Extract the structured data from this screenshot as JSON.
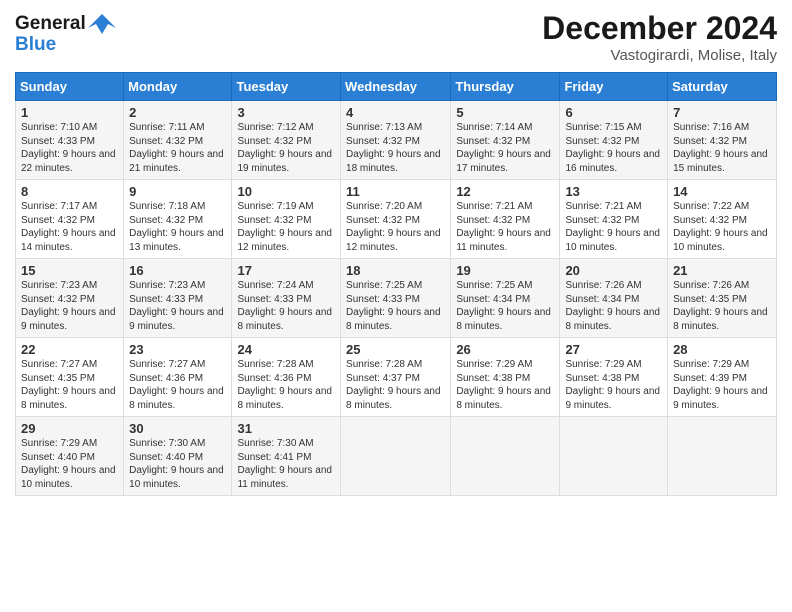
{
  "logo": {
    "line1": "General",
    "line2": "Blue"
  },
  "title": "December 2024",
  "subtitle": "Vastogirardi, Molise, Italy",
  "days": [
    "Sunday",
    "Monday",
    "Tuesday",
    "Wednesday",
    "Thursday",
    "Friday",
    "Saturday"
  ],
  "weeks": [
    [
      {
        "day": "1",
        "sunrise": "7:10 AM",
        "sunset": "4:33 PM",
        "daylight": "9 hours and 22 minutes."
      },
      {
        "day": "2",
        "sunrise": "7:11 AM",
        "sunset": "4:32 PM",
        "daylight": "9 hours and 21 minutes."
      },
      {
        "day": "3",
        "sunrise": "7:12 AM",
        "sunset": "4:32 PM",
        "daylight": "9 hours and 19 minutes."
      },
      {
        "day": "4",
        "sunrise": "7:13 AM",
        "sunset": "4:32 PM",
        "daylight": "9 hours and 18 minutes."
      },
      {
        "day": "5",
        "sunrise": "7:14 AM",
        "sunset": "4:32 PM",
        "daylight": "9 hours and 17 minutes."
      },
      {
        "day": "6",
        "sunrise": "7:15 AM",
        "sunset": "4:32 PM",
        "daylight": "9 hours and 16 minutes."
      },
      {
        "day": "7",
        "sunrise": "7:16 AM",
        "sunset": "4:32 PM",
        "daylight": "9 hours and 15 minutes."
      }
    ],
    [
      {
        "day": "8",
        "sunrise": "7:17 AM",
        "sunset": "4:32 PM",
        "daylight": "9 hours and 14 minutes."
      },
      {
        "day": "9",
        "sunrise": "7:18 AM",
        "sunset": "4:32 PM",
        "daylight": "9 hours and 13 minutes."
      },
      {
        "day": "10",
        "sunrise": "7:19 AM",
        "sunset": "4:32 PM",
        "daylight": "9 hours and 12 minutes."
      },
      {
        "day": "11",
        "sunrise": "7:20 AM",
        "sunset": "4:32 PM",
        "daylight": "9 hours and 12 minutes."
      },
      {
        "day": "12",
        "sunrise": "7:21 AM",
        "sunset": "4:32 PM",
        "daylight": "9 hours and 11 minutes."
      },
      {
        "day": "13",
        "sunrise": "7:21 AM",
        "sunset": "4:32 PM",
        "daylight": "9 hours and 10 minutes."
      },
      {
        "day": "14",
        "sunrise": "7:22 AM",
        "sunset": "4:32 PM",
        "daylight": "9 hours and 10 minutes."
      }
    ],
    [
      {
        "day": "15",
        "sunrise": "7:23 AM",
        "sunset": "4:32 PM",
        "daylight": "9 hours and 9 minutes."
      },
      {
        "day": "16",
        "sunrise": "7:23 AM",
        "sunset": "4:33 PM",
        "daylight": "9 hours and 9 minutes."
      },
      {
        "day": "17",
        "sunrise": "7:24 AM",
        "sunset": "4:33 PM",
        "daylight": "9 hours and 8 minutes."
      },
      {
        "day": "18",
        "sunrise": "7:25 AM",
        "sunset": "4:33 PM",
        "daylight": "9 hours and 8 minutes."
      },
      {
        "day": "19",
        "sunrise": "7:25 AM",
        "sunset": "4:34 PM",
        "daylight": "9 hours and 8 minutes."
      },
      {
        "day": "20",
        "sunrise": "7:26 AM",
        "sunset": "4:34 PM",
        "daylight": "9 hours and 8 minutes."
      },
      {
        "day": "21",
        "sunrise": "7:26 AM",
        "sunset": "4:35 PM",
        "daylight": "9 hours and 8 minutes."
      }
    ],
    [
      {
        "day": "22",
        "sunrise": "7:27 AM",
        "sunset": "4:35 PM",
        "daylight": "9 hours and 8 minutes."
      },
      {
        "day": "23",
        "sunrise": "7:27 AM",
        "sunset": "4:36 PM",
        "daylight": "9 hours and 8 minutes."
      },
      {
        "day": "24",
        "sunrise": "7:28 AM",
        "sunset": "4:36 PM",
        "daylight": "9 hours and 8 minutes."
      },
      {
        "day": "25",
        "sunrise": "7:28 AM",
        "sunset": "4:37 PM",
        "daylight": "9 hours and 8 minutes."
      },
      {
        "day": "26",
        "sunrise": "7:29 AM",
        "sunset": "4:38 PM",
        "daylight": "9 hours and 8 minutes."
      },
      {
        "day": "27",
        "sunrise": "7:29 AM",
        "sunset": "4:38 PM",
        "daylight": "9 hours and 9 minutes."
      },
      {
        "day": "28",
        "sunrise": "7:29 AM",
        "sunset": "4:39 PM",
        "daylight": "9 hours and 9 minutes."
      }
    ],
    [
      {
        "day": "29",
        "sunrise": "7:29 AM",
        "sunset": "4:40 PM",
        "daylight": "9 hours and 10 minutes."
      },
      {
        "day": "30",
        "sunrise": "7:30 AM",
        "sunset": "4:40 PM",
        "daylight": "9 hours and 10 minutes."
      },
      {
        "day": "31",
        "sunrise": "7:30 AM",
        "sunset": "4:41 PM",
        "daylight": "9 hours and 11 minutes."
      },
      null,
      null,
      null,
      null
    ]
  ]
}
